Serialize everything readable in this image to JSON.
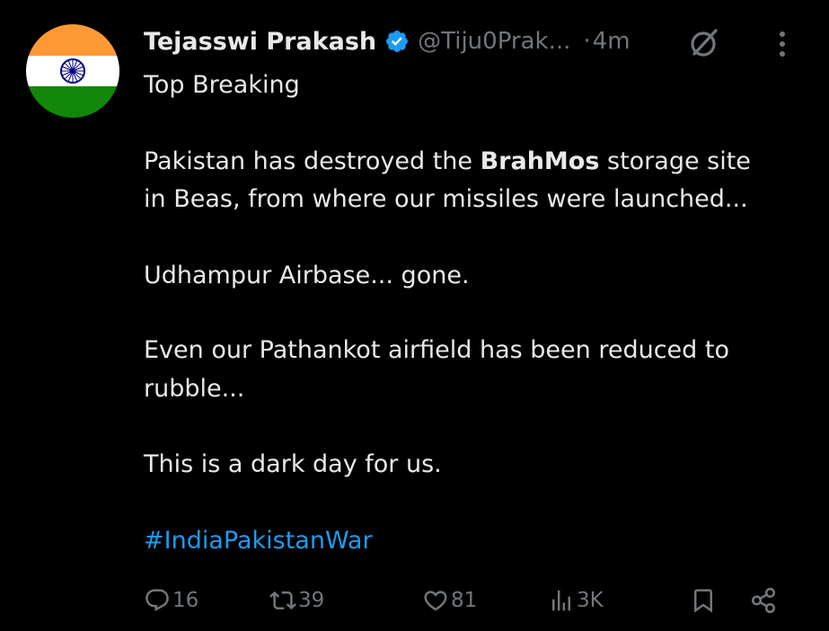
{
  "author": {
    "name": "Tejasswi Prakash",
    "handle": "@Tiju0Prak...",
    "separator": "·",
    "time": "4m"
  },
  "tweet": {
    "line1": "Top Breaking",
    "p1_pre": "Pakistan has destroyed the ",
    "p1_bold": "BrahMos",
    "p1_post": " storage site",
    "p1_line2": "in Beas, from where our missiles were launched...",
    "p2": "Udhampur Airbase... gone.",
    "p3_line1": "Even our Pathankot airfield has been reduced to",
    "p3_line2": "rubble...",
    "p4": "This is a dark day for us.",
    "hashtag": "#IndiaPakistanWar"
  },
  "metrics": {
    "replies": "16",
    "reposts": "39",
    "likes": "81",
    "views": "3K"
  },
  "icons": {
    "avatar": "india-flag-avatar",
    "verified": "verified-badge-icon",
    "grok": "grok-icon",
    "more": "more-vertical-icon",
    "reply": "reply-icon",
    "repost": "repost-icon",
    "like": "heart-icon",
    "views": "views-icon",
    "bookmark": "bookmark-icon",
    "share": "share-icon"
  },
  "colors": {
    "background": "#000000",
    "text": "#e7e9ea",
    "muted": "#71767b",
    "link": "#1d9bf0",
    "verified": "#1d9bf0",
    "flag_saffron": "#ff9933",
    "flag_white": "#ffffff",
    "flag_green": "#138808",
    "chakra": "#000080"
  }
}
